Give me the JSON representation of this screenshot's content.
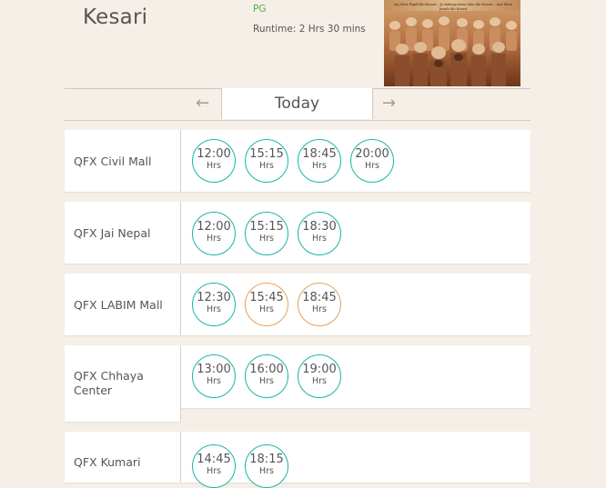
{
  "movie": {
    "title": "Kesari",
    "rating": "PG",
    "runtime": "Runtime: 2 Hrs 30 mins",
    "poster_tagline": "Aaj Meri Pagdi bhi Kesari... Jo bahega mera lahu bhi Kesari... Aur Mera Jawab bhi Kesari"
  },
  "date_nav": {
    "prev_arrow": "←",
    "label": "Today",
    "next_arrow": "→"
  },
  "colors": {
    "available": "#19b5a2",
    "filling": "#e8a05a",
    "rating": "#4caf50"
  },
  "theatres": [
    {
      "name": "QFX Civil Mall",
      "shows": [
        {
          "time": "12:00",
          "unit": "Hrs",
          "status": "available"
        },
        {
          "time": "15:15",
          "unit": "Hrs",
          "status": "available"
        },
        {
          "time": "18:45",
          "unit": "Hrs",
          "status": "available"
        },
        {
          "time": "20:00",
          "unit": "Hrs",
          "status": "available"
        }
      ]
    },
    {
      "name": "QFX Jai Nepal",
      "shows": [
        {
          "time": "12:00",
          "unit": "Hrs",
          "status": "available"
        },
        {
          "time": "15:15",
          "unit": "Hrs",
          "status": "available"
        },
        {
          "time": "18:30",
          "unit": "Hrs",
          "status": "available"
        }
      ]
    },
    {
      "name": "QFX LABIM Mall",
      "shows": [
        {
          "time": "12:30",
          "unit": "Hrs",
          "status": "available"
        },
        {
          "time": "15:45",
          "unit": "Hrs",
          "status": "filling"
        },
        {
          "time": "18:45",
          "unit": "Hrs",
          "status": "filling"
        }
      ]
    },
    {
      "name": "QFX Chhaya Center",
      "name_line1": "QFX Chhaya",
      "name_line2": "Center",
      "shows": [
        {
          "time": "13:00",
          "unit": "Hrs",
          "status": "available"
        },
        {
          "time": "16:00",
          "unit": "Hrs",
          "status": "available"
        },
        {
          "time": "19:00",
          "unit": "Hrs",
          "status": "available"
        }
      ]
    },
    {
      "name": "QFX Kumari",
      "shows": [
        {
          "time": "14:45",
          "unit": "Hrs",
          "status": "available"
        },
        {
          "time": "18:15",
          "unit": "Hrs",
          "status": "available"
        }
      ]
    }
  ]
}
